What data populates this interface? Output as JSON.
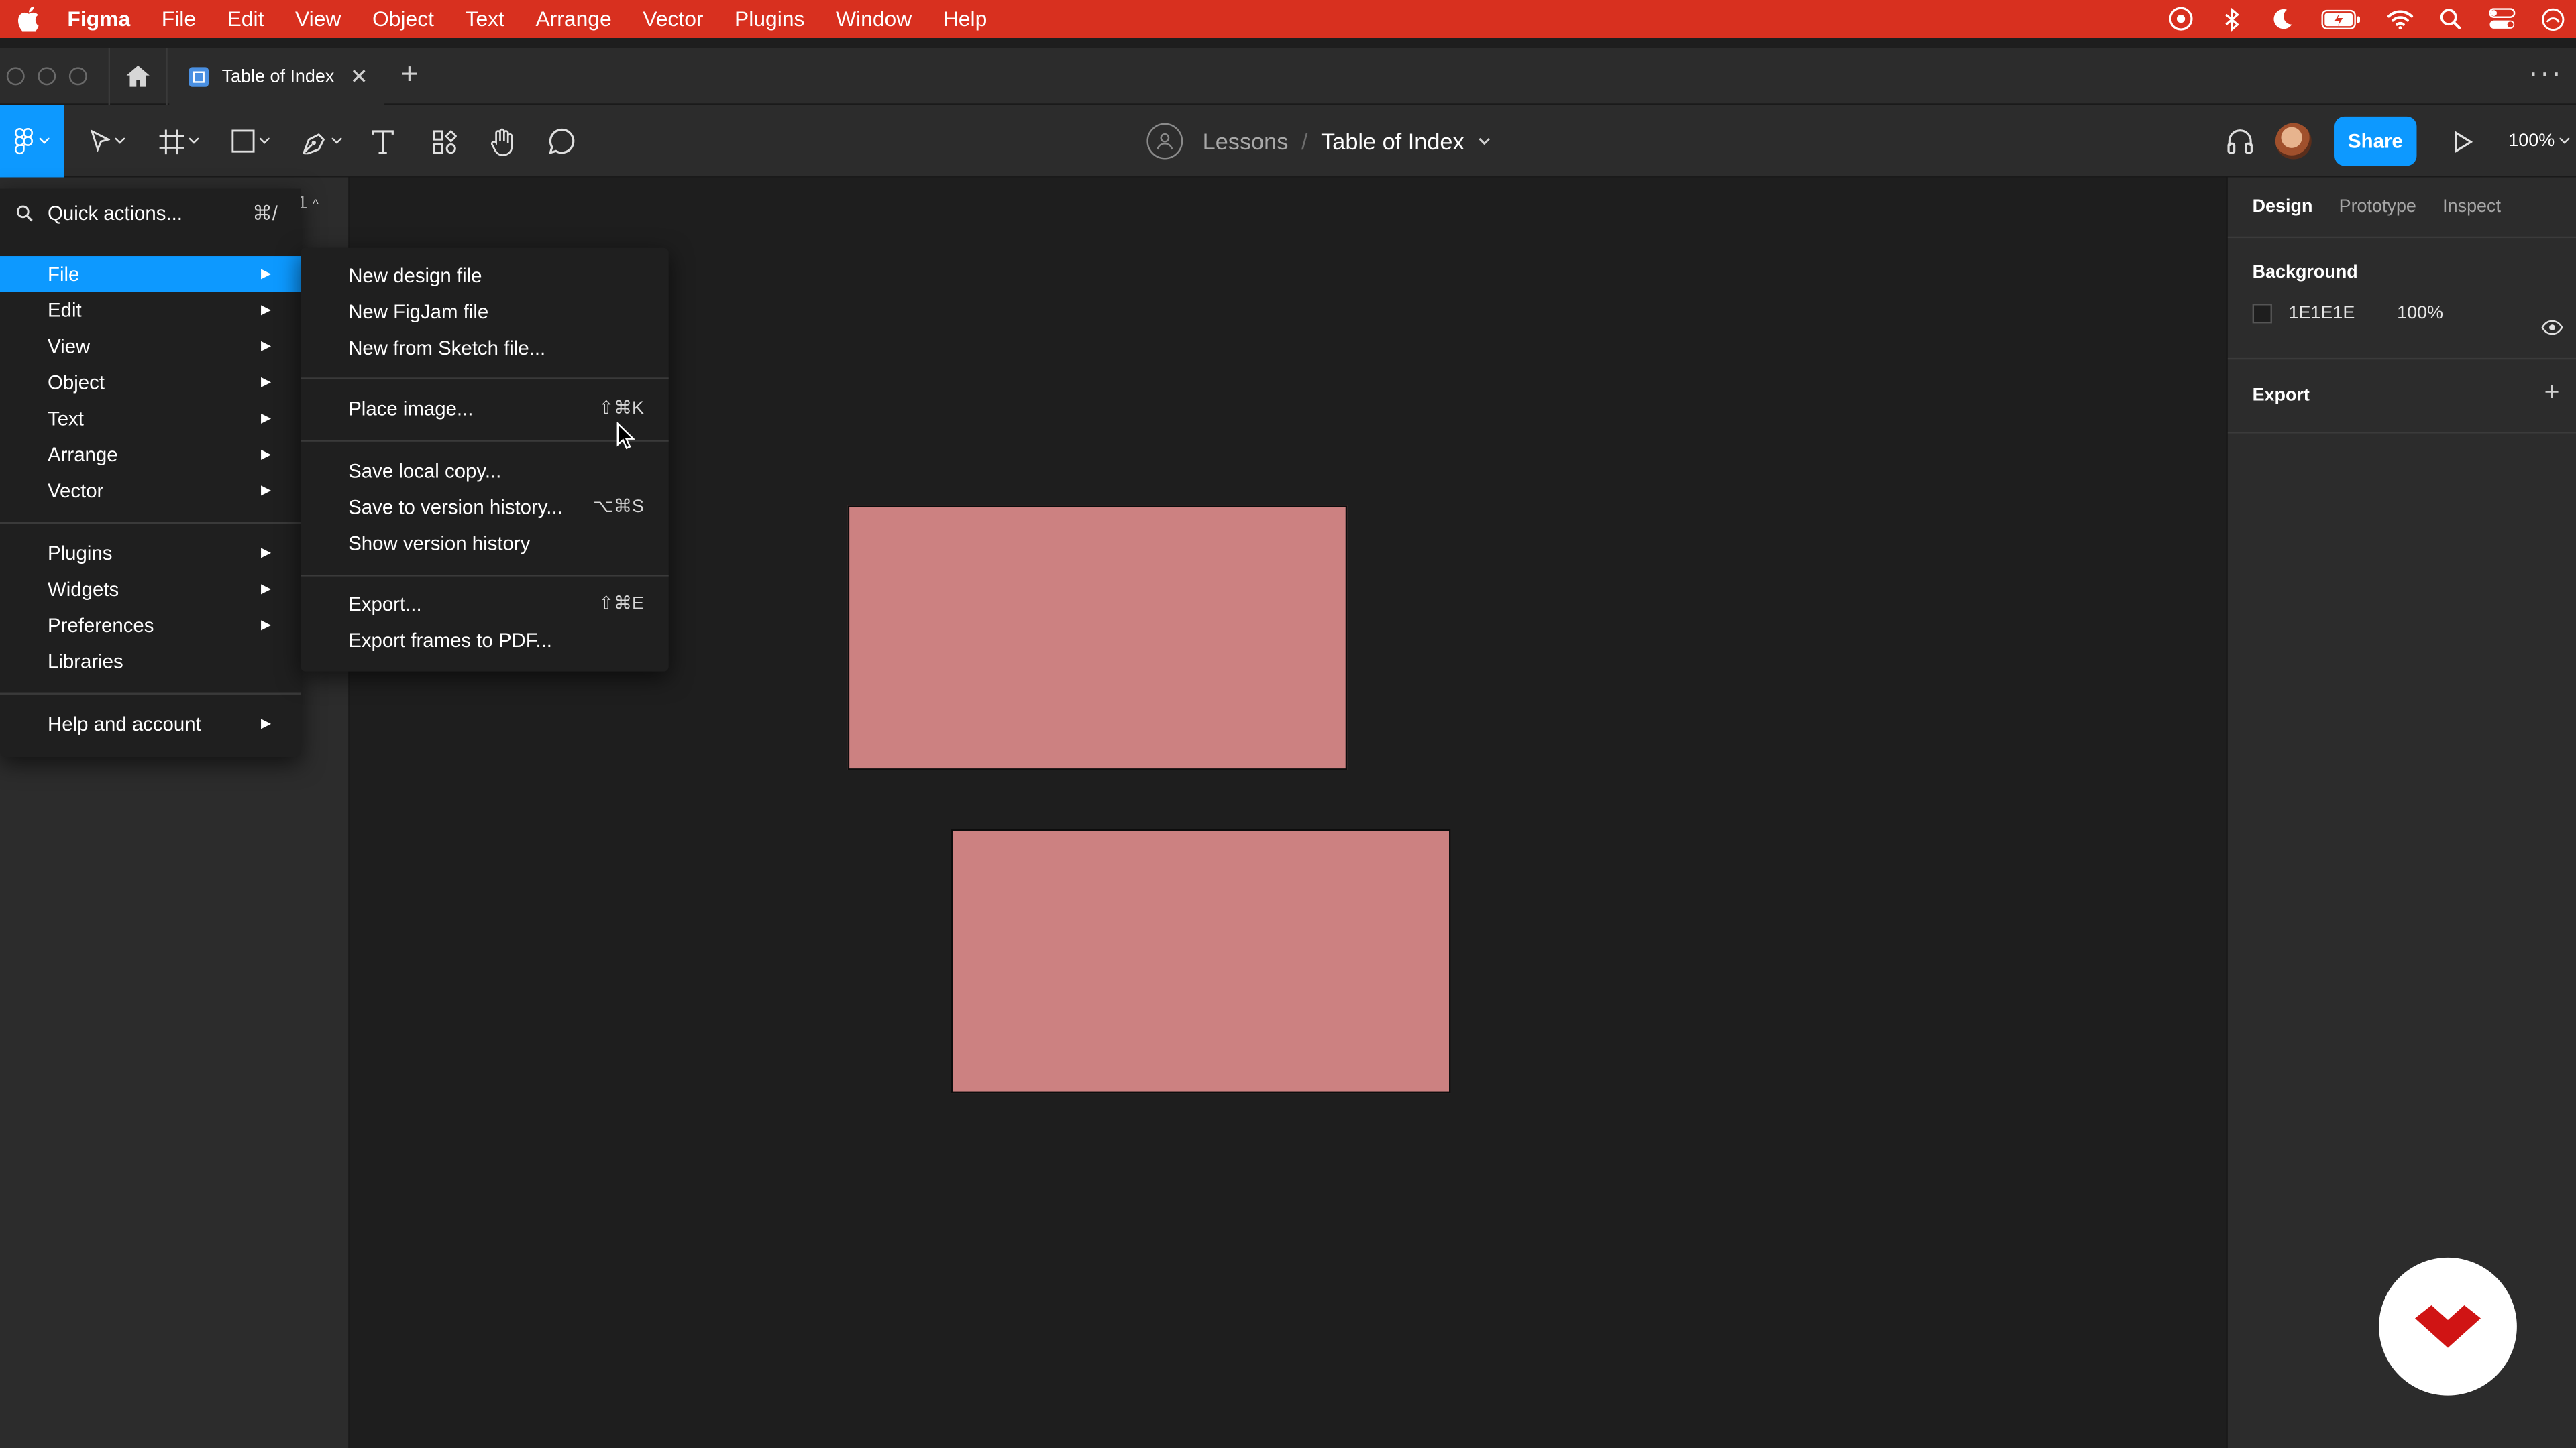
{
  "menubar": {
    "app": "Figma",
    "items": [
      "File",
      "Edit",
      "View",
      "Object",
      "Text",
      "Arrange",
      "Vector",
      "Plugins",
      "Window",
      "Help"
    ]
  },
  "tabbar": {
    "tab_title": "Table of Index"
  },
  "toolbar": {
    "breadcrumb_project": "Lessons",
    "breadcrumb_separator": "/",
    "file_name": "Table of Index",
    "share_label": "Share",
    "zoom": "100%"
  },
  "left_panel": {
    "page_indicator": "1"
  },
  "main_menu": {
    "quick_actions": {
      "label": "Quick actions...",
      "shortcut": "⌘/"
    },
    "items": [
      {
        "label": "File"
      },
      {
        "label": "Edit"
      },
      {
        "label": "View"
      },
      {
        "label": "Object"
      },
      {
        "label": "Text"
      },
      {
        "label": "Arrange"
      },
      {
        "label": "Vector"
      },
      {
        "label": "Plugins"
      },
      {
        "label": "Widgets"
      },
      {
        "label": "Preferences"
      },
      {
        "label": "Libraries"
      },
      {
        "label": "Help and account"
      }
    ]
  },
  "file_submenu": {
    "items": [
      {
        "label": "New design file",
        "shortcut": ""
      },
      {
        "label": "New FigJam file",
        "shortcut": ""
      },
      {
        "label": "New from Sketch file...",
        "shortcut": ""
      },
      {
        "label": "Place image...",
        "shortcut": "⇧⌘K"
      },
      {
        "label": "Save local copy...",
        "shortcut": ""
      },
      {
        "label": "Save to version history...",
        "shortcut": "⌥⌘S"
      },
      {
        "label": "Show version history",
        "shortcut": ""
      },
      {
        "label": "Export...",
        "shortcut": "⇧⌘E"
      },
      {
        "label": "Export frames to PDF...",
        "shortcut": ""
      }
    ]
  },
  "right_panel": {
    "tabs": [
      "Design",
      "Prototype",
      "Inspect"
    ],
    "background_title": "Background",
    "background_hex": "1E1E1E",
    "background_opacity": "100%",
    "export_title": "Export"
  },
  "colors": {
    "menubar": "#d8301f",
    "accent": "#0d99ff",
    "rectangle_fill": "#cc8181",
    "canvas": "#1e1e1e",
    "panel": "#2c2c2c"
  }
}
